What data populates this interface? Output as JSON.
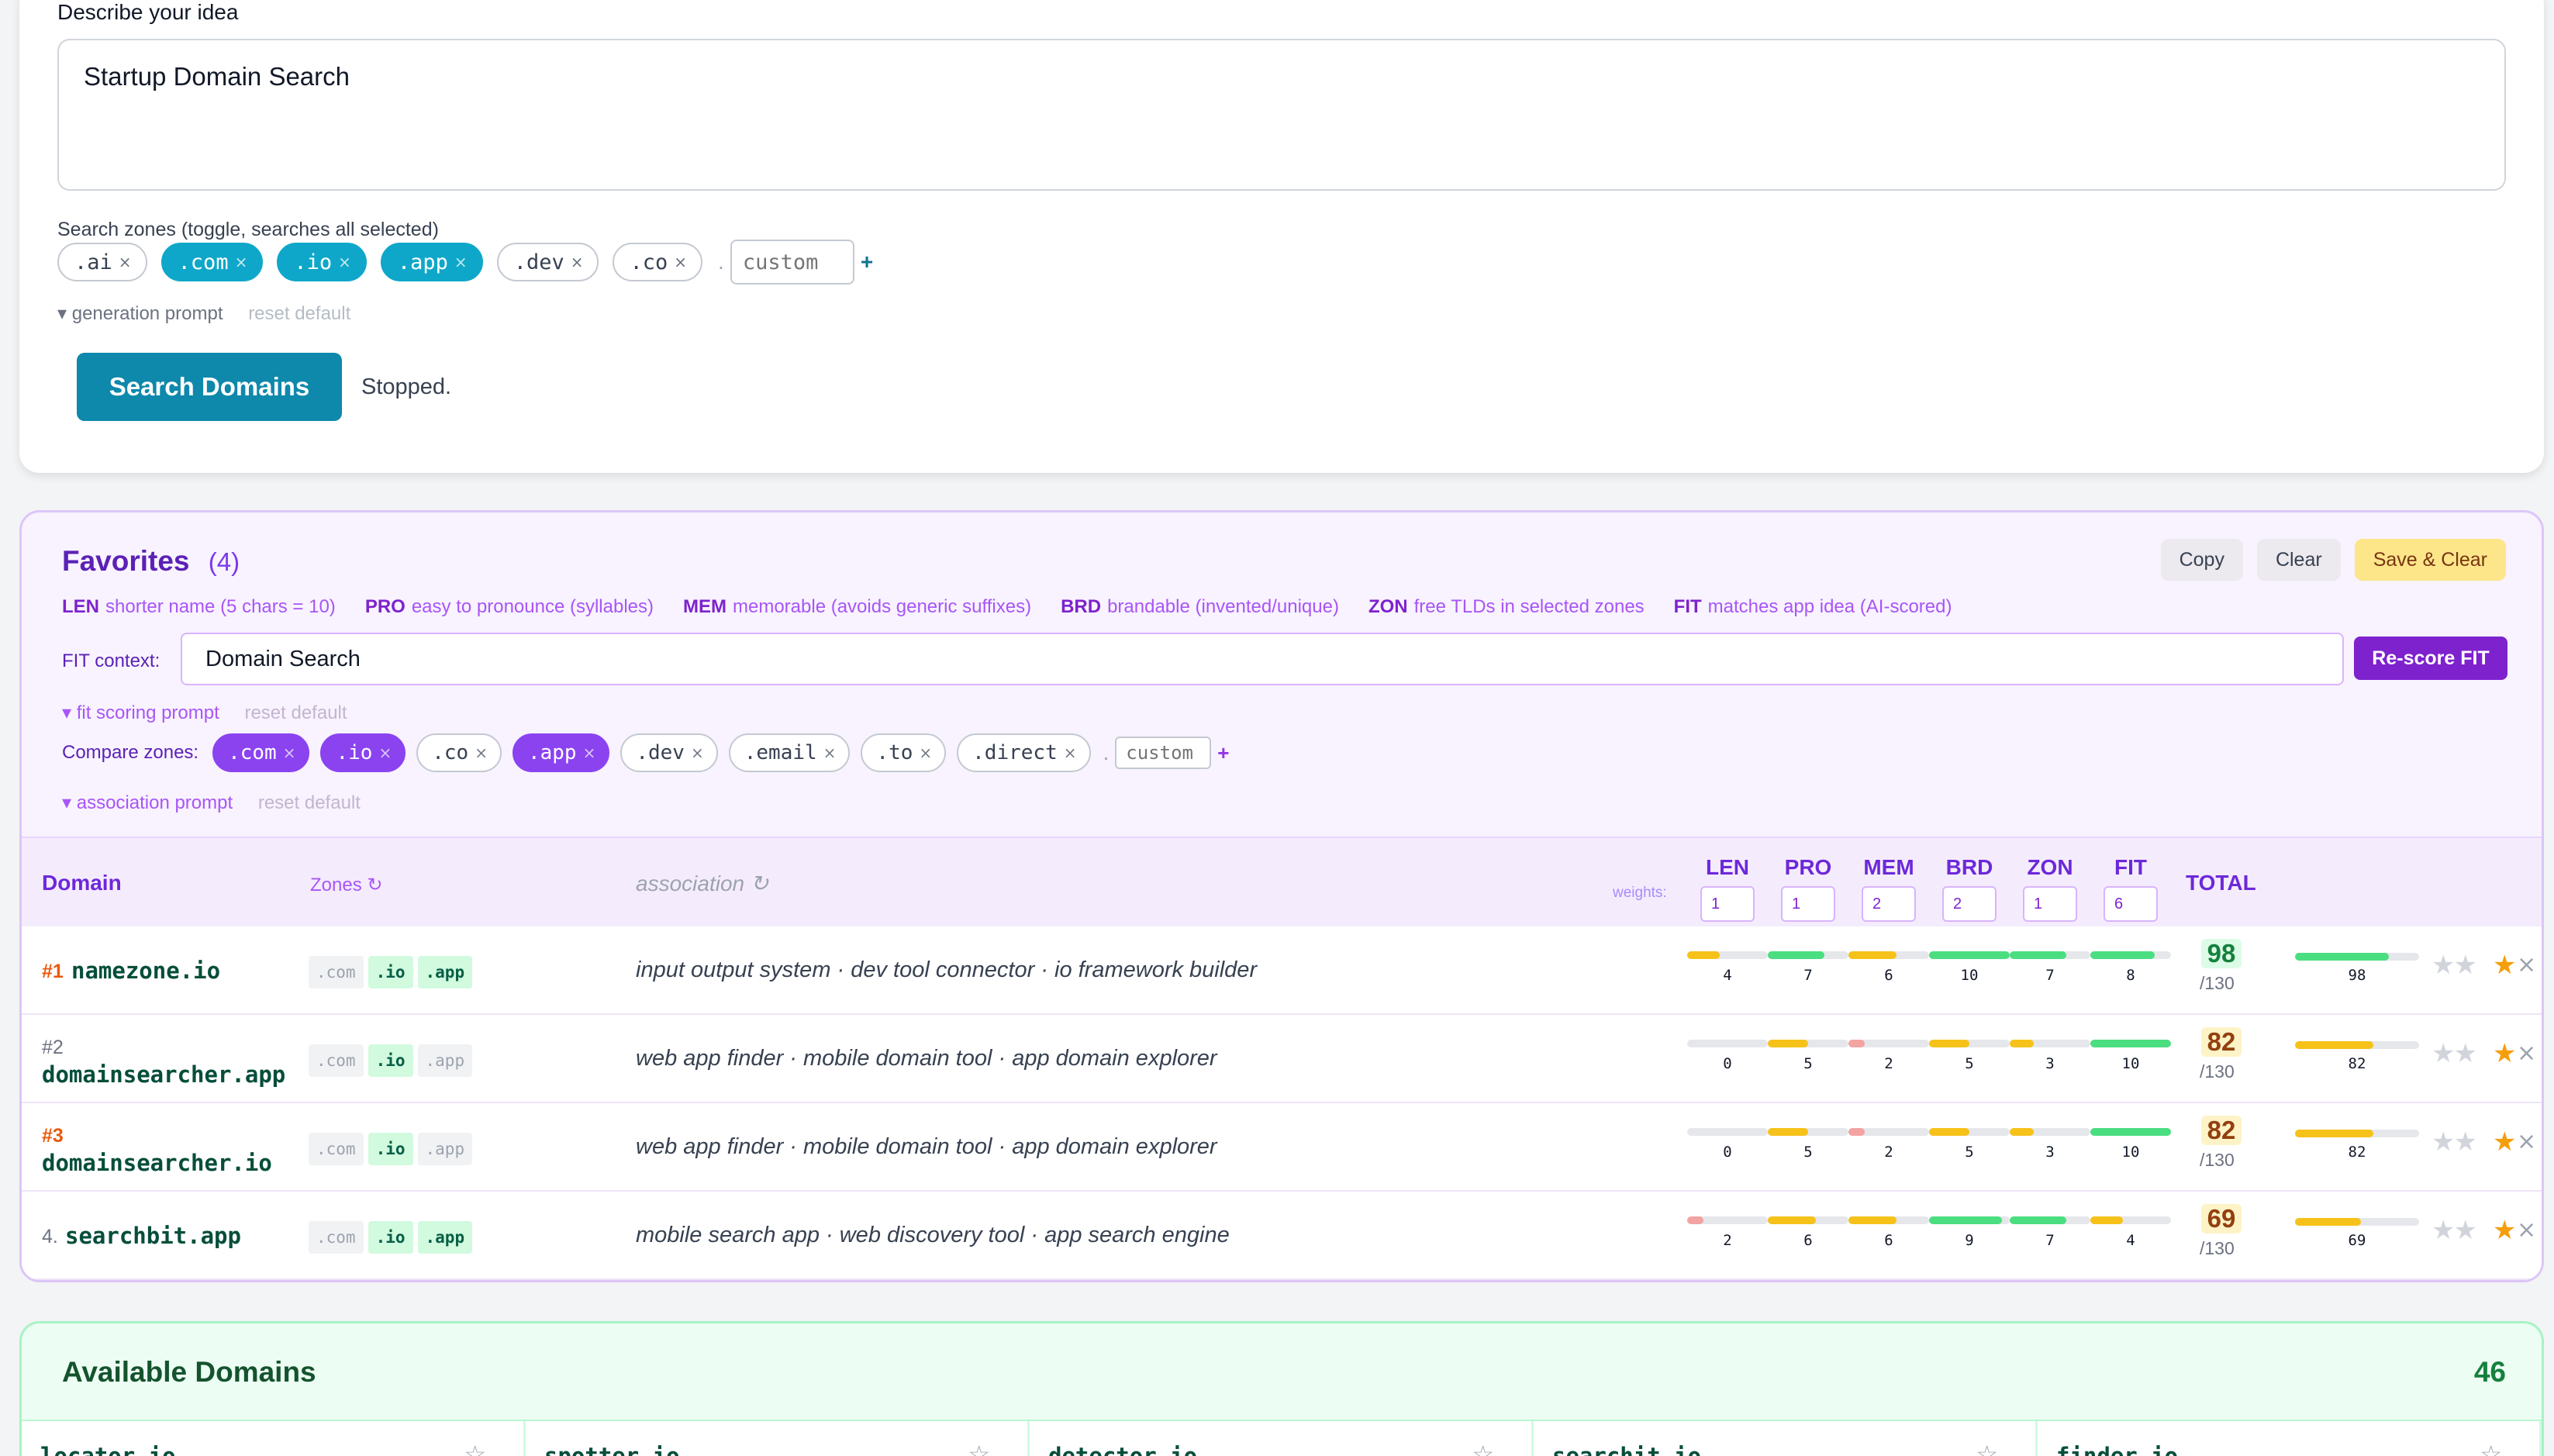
{
  "search": {
    "idea_label": "Describe your idea",
    "idea_value": "Startup Domain Search",
    "zones_label": "Search zones (toggle, searches all selected)",
    "zones": [
      {
        "label": ".ai",
        "active": false
      },
      {
        "label": ".com",
        "active": true
      },
      {
        "label": ".io",
        "active": true
      },
      {
        "label": ".app",
        "active": true
      },
      {
        "label": ".dev",
        "active": false
      },
      {
        "label": ".co",
        "active": false
      }
    ],
    "custom_placeholder": "custom",
    "add_symbol": "+",
    "dot": ".",
    "generation_prompt": "▾ generation prompt",
    "reset_default": "reset default",
    "search_button": "Search Domains",
    "status": "Stopped.",
    "accent_color": "#0e88ab"
  },
  "favorites": {
    "title": "Favorites",
    "count": "(4)",
    "actions": {
      "copy": "Copy",
      "clear": "Clear",
      "save_clear": "Save & Clear"
    },
    "legend": [
      {
        "key": "LEN",
        "desc": "shorter name (5 chars = 10)"
      },
      {
        "key": "PRO",
        "desc": "easy to pronounce (syllables)"
      },
      {
        "key": "MEM",
        "desc": "memorable (avoids generic suffixes)"
      },
      {
        "key": "BRD",
        "desc": "brandable (invented/unique)"
      },
      {
        "key": "ZON",
        "desc": "free TLDs in selected zones"
      },
      {
        "key": "FIT",
        "desc": "matches app idea (AI-scored)"
      }
    ],
    "fit_label": "FIT context:",
    "fit_value": "Domain Search",
    "rescore_button": "Re-score FIT",
    "fit_prompt": "▾ fit scoring prompt",
    "reset_default": "reset default",
    "compare_label": "Compare zones:",
    "compare_zones": [
      {
        "label": ".com",
        "active": true
      },
      {
        "label": ".io",
        "active": true
      },
      {
        "label": ".co",
        "active": false
      },
      {
        "label": ".app",
        "active": true
      },
      {
        "label": ".dev",
        "active": false
      },
      {
        "label": ".email",
        "active": false
      },
      {
        "label": ".to",
        "active": false
      },
      {
        "label": ".direct",
        "active": false
      }
    ],
    "custom_placeholder": "custom",
    "assoc_prompt": "▾ association prompt",
    "accent_color": "#7e22ce",
    "table": {
      "col_domain": "Domain",
      "col_zones": "Zones ↻",
      "col_assoc": "association ↻",
      "weights_label": "weights:",
      "weights": [
        {
          "name": "LEN",
          "value": "1"
        },
        {
          "name": "PRO",
          "value": "1"
        },
        {
          "name": "MEM",
          "value": "2"
        },
        {
          "name": "BRD",
          "value": "2"
        },
        {
          "name": "ZON",
          "value": "1"
        },
        {
          "name": "FIT",
          "value": "6"
        }
      ],
      "col_total": "TOTAL",
      "rows": [
        {
          "rank": "#1",
          "rank_style": "gold",
          "two_line": false,
          "domain": "namezone.io",
          "zones": [
            {
              "label": ".com",
              "avail": false
            },
            {
              "label": ".io",
              "avail": true
            },
            {
              "label": ".app",
              "avail": true
            }
          ],
          "association": "input output system · dev tool connector · io framework builder",
          "scores": [
            4,
            7,
            6,
            10,
            7,
            8
          ],
          "total": "98",
          "max": "/130",
          "total_value": 98,
          "total_color": "green",
          "starred": true
        },
        {
          "rank": "#2",
          "rank_style": "grey",
          "two_line": true,
          "domain": "domainsearcher.app",
          "zones": [
            {
              "label": ".com",
              "avail": false
            },
            {
              "label": ".io",
              "avail": true
            },
            {
              "label": ".app",
              "avail": false
            }
          ],
          "association": "web app finder · mobile domain tool · app domain explorer",
          "scores": [
            0,
            5,
            2,
            5,
            3,
            10
          ],
          "total": "82",
          "max": "/130",
          "total_value": 82,
          "total_color": "yellow",
          "starred": true
        },
        {
          "rank": "#3",
          "rank_style": "gold",
          "two_line": true,
          "domain": "domainsearcher.io",
          "zones": [
            {
              "label": ".com",
              "avail": false
            },
            {
              "label": ".io",
              "avail": true
            },
            {
              "label": ".app",
              "avail": false
            }
          ],
          "association": "web app finder · mobile domain tool · app domain explorer",
          "scores": [
            0,
            5,
            2,
            5,
            3,
            10
          ],
          "total": "82",
          "max": "/130",
          "total_value": 82,
          "total_color": "yellow",
          "starred": true
        },
        {
          "rank": "4.",
          "rank_style": "grey",
          "two_line": false,
          "domain": "searchbit.app",
          "zones": [
            {
              "label": ".com",
              "avail": false
            },
            {
              "label": ".io",
              "avail": true
            },
            {
              "label": ".app",
              "avail": true
            }
          ],
          "association": "mobile search app · web discovery tool · app search engine",
          "scores": [
            2,
            6,
            6,
            9,
            7,
            4
          ],
          "total": "69",
          "max": "/130",
          "total_value": 69,
          "total_color": "yellow",
          "starred": true
        }
      ]
    }
  },
  "available": {
    "title": "Available Domains",
    "count": "46",
    "items": [
      "locator.io",
      "spotter.io",
      "detector.io",
      "searchit.io",
      "finder.io"
    ],
    "accent_color": "#15803d"
  },
  "icons": {
    "chip_remove": "close-icon",
    "star": "star-icon",
    "remove_row": "close-icon",
    "refresh": "refresh-icon",
    "collapse": "triangle-down-icon"
  }
}
